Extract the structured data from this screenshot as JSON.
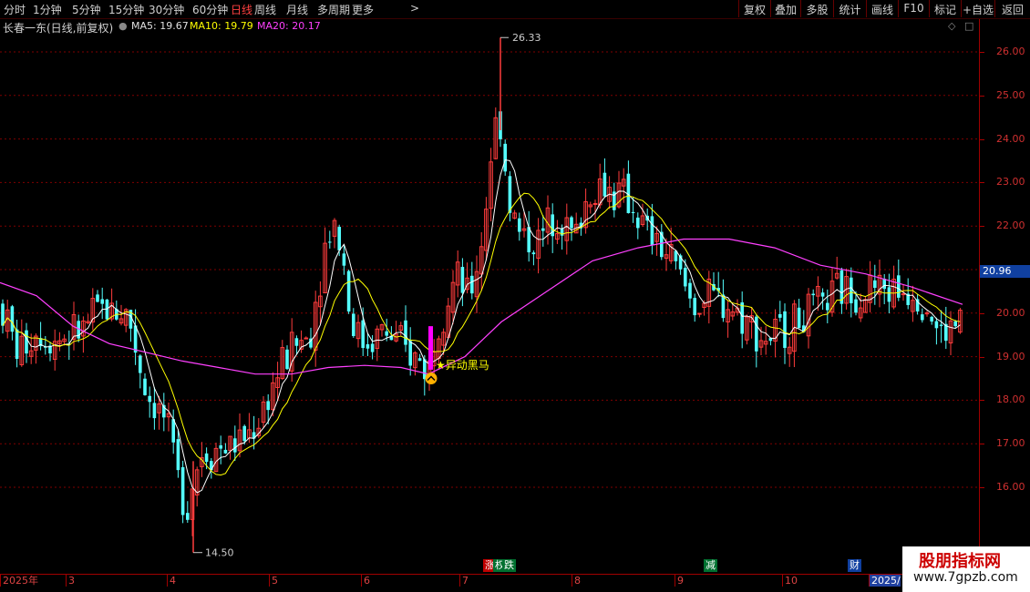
{
  "toolbar": {
    "periods": [
      "分时",
      "1分钟",
      "5分钟",
      "15分钟",
      "30分钟",
      "60分钟",
      "日线",
      "周线",
      "月线",
      "多周期",
      "更多"
    ],
    "active_period": "日线",
    "more_arrow": ">",
    "right_buttons": [
      "复权",
      "叠加",
      "多股",
      "统计",
      "画线",
      "F10",
      "标记",
      "+自选",
      "返回"
    ]
  },
  "titlebar": {
    "stock": "长春一东(日线,前复权)",
    "ma5": "MA5: 19.67",
    "ma10": "MA10: 19.79",
    "ma20": "MA20: 20.17"
  },
  "colors": {
    "up": "#ff3c3c",
    "down": "#54ffff",
    "ma5": "#ffffff",
    "ma10": "#ffff00",
    "ma20": "#ff40ff",
    "grid": "#800000",
    "axis_text": "#d03030",
    "signal": "#ff00ff"
  },
  "y_axis": {
    "ticks": [
      "26.00",
      "25.00",
      "24.00",
      "23.00",
      "22.00",
      "21.00",
      "20.00",
      "19.00",
      "18.00",
      "17.00",
      "16.00"
    ],
    "current_price_label": "20.96"
  },
  "annotations": {
    "high": "26.33",
    "low": "14.50",
    "signal_label": "★异动黑马"
  },
  "date_axis": {
    "labels": [
      "2025年",
      "3",
      "4",
      "5",
      "6",
      "7",
      "8",
      "9",
      "10",
      "2025/"
    ]
  },
  "events": [
    "涨",
    "权",
    "跌",
    "减",
    "财"
  ],
  "watermark": {
    "title": "股朋指标网",
    "url": "www.7gpzb.com"
  },
  "chart_data": {
    "type": "candlestick",
    "ylim": [
      14.3,
      26.6
    ],
    "x_range": "2025年2月 – 2025年10月",
    "high": 26.33,
    "low": 14.5,
    "current": 20.96,
    "ma20_approx": [
      20.7,
      20.6,
      20.3,
      19.9,
      19.5,
      19.2,
      18.9,
      18.7,
      18.6,
      18.5,
      18.6,
      18.8,
      18.8,
      18.7,
      18.7,
      19.0,
      19.7,
      20.4,
      20.9,
      21.4,
      21.6,
      21.6,
      21.8,
      21.8,
      21.7,
      21.2,
      21.0,
      20.9,
      20.8,
      20.5,
      20.3,
      20.2
    ],
    "close_approx": [
      19.9,
      19.3,
      19.5,
      20.0,
      19.3,
      18.5,
      17.8,
      16.4,
      16.9,
      17.2,
      17.9,
      19.0,
      22.3,
      20.5,
      19.6,
      19.4,
      18.9,
      19.6,
      21.0,
      24.1,
      22.2,
      21.7,
      22.8,
      23.0,
      22.3,
      20.4,
      20.2,
      19.6,
      20.3,
      20.7,
      20.4,
      19.9
    ]
  }
}
